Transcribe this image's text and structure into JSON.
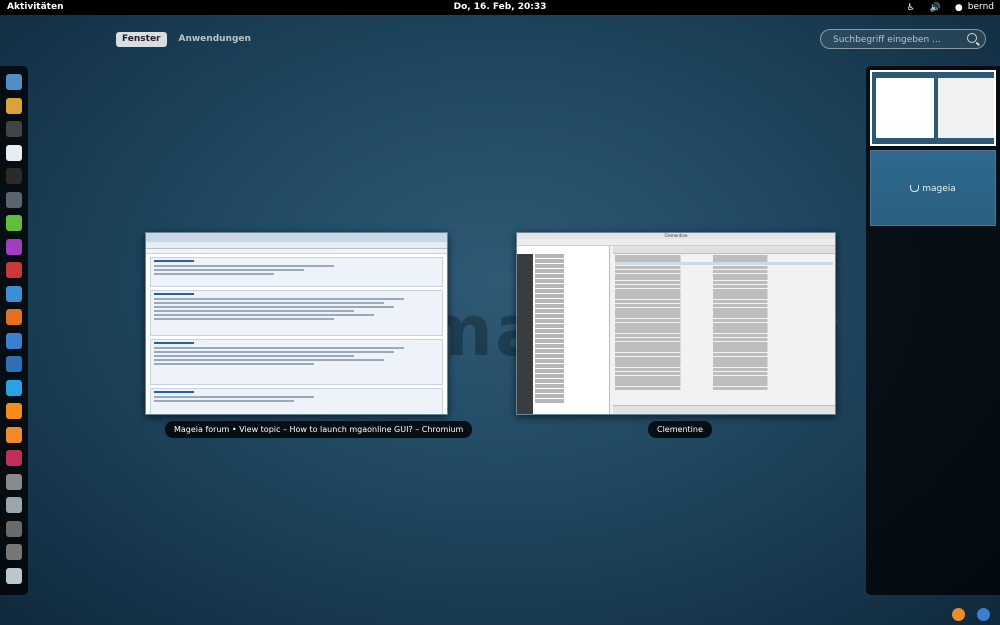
{
  "topbar": {
    "activities": "Aktivitäten",
    "clock": "Do, 16. Feb, 20:33",
    "user": "bernd",
    "icons": [
      "accessibility-icon",
      "volume-icon",
      "user-icon"
    ]
  },
  "view_selector": {
    "windows_label": "Fenster",
    "apps_label": "Anwendungen",
    "active": "Fenster"
  },
  "search": {
    "placeholder": "Suchbegriff eingeben …"
  },
  "dash": {
    "apps": [
      {
        "name": "image-viewer-icon",
        "color": "#4f8fc4"
      },
      {
        "name": "tools-icon",
        "color": "#d9a33a"
      },
      {
        "name": "terminal-icon",
        "color": "#444444"
      },
      {
        "name": "document-icon",
        "color": "#e8edf3"
      },
      {
        "name": "console-icon",
        "color": "#2b2b2b"
      },
      {
        "name": "monitor-icon",
        "color": "#5a6570"
      },
      {
        "name": "leaf-icon",
        "color": "#5fbf3a"
      },
      {
        "name": "wave-icon",
        "color": "#a040c0"
      },
      {
        "name": "red-app-icon",
        "color": "#c83a3a"
      },
      {
        "name": "globe-icon",
        "color": "#3b8fd9"
      },
      {
        "name": "firefox-icon",
        "color": "#e2701e"
      },
      {
        "name": "chromium-icon",
        "color": "#3a7fd0"
      },
      {
        "name": "network-icon",
        "color": "#2f6fb5"
      },
      {
        "name": "skype-icon",
        "color": "#27a3e3"
      },
      {
        "name": "vlc-icon",
        "color": "#f28c1a"
      },
      {
        "name": "clementine-icon",
        "color": "#f08a2a"
      },
      {
        "name": "game-icon",
        "color": "#c0305a"
      },
      {
        "name": "printer-icon",
        "color": "#8a8a8a"
      },
      {
        "name": "settings-icon",
        "color": "#9aa5ad"
      },
      {
        "name": "disc-icon",
        "color": "#6a6a6a"
      },
      {
        "name": "drive-icon",
        "color": "#777777"
      },
      {
        "name": "calculator-icon",
        "color": "#b9c7d1"
      }
    ]
  },
  "windows": [
    {
      "caption": "Mageia forum • View topic – How to launch mgaonline GUI? – Chromium"
    },
    {
      "caption": "Clementine",
      "title": "Clementine"
    }
  ],
  "workspace_logo": "mageia",
  "watermark": "ma"
}
